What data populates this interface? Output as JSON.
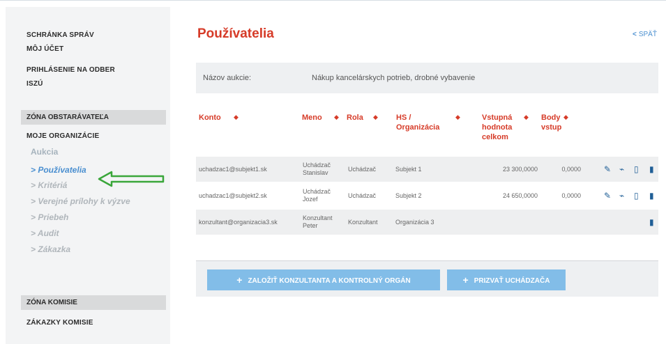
{
  "sidebar": {
    "links": [
      "SCHRÁNKA SPRÁV",
      "MÔJ ÚČET",
      "PRIHLÁSENIE NA ODBER",
      "ISZÚ"
    ],
    "zone_obstaravatela": "ZÓNA OBSTARÁVATEĽA",
    "moje_organizacie": "MOJE ORGANIZÁCIE",
    "aukcia": "Aukcia",
    "sub_items": [
      "> Používatelia",
      "> Kritériá",
      "> Verejné prílohy k výzve",
      "> Priebeh",
      "> Audit",
      "> Zákazka"
    ],
    "zone_komisie": "ZÓNA KOMISIE",
    "zakazky_komisie": "ZÁKAZKY KOMISIE"
  },
  "main": {
    "title": "Používatelia",
    "back_label": "SPÄŤ",
    "info": {
      "label": "Názov aukcie:",
      "value": "Nákup kancelárskych potrieb, drobné vybavenie"
    },
    "columns": {
      "konto": "Konto",
      "meno": "Meno",
      "rola": "Rola",
      "hs_1": "HS /",
      "hs_2": "Organizácia",
      "vstupna_1": "Vstupná",
      "vstupna_2": "hodnota",
      "vstupna_3": "celkom",
      "body_1": "Body",
      "body_2": "vstup"
    },
    "rows": [
      {
        "konto": "uchadzac1@subjekt1.sk",
        "meno_1": "Uchádzač",
        "meno_2": "Stanislav",
        "rola": "Uchádzač",
        "org": "Subjekt 1",
        "hodnota": "23 300,0000",
        "body": "0,0000"
      },
      {
        "konto": "uchadzac1@subjekt2.sk",
        "meno_1": "Uchádzač",
        "meno_2": "Jozef",
        "rola": "Uchádzač",
        "org": "Subjekt 2",
        "hodnota": "24 650,0000",
        "body": "0,0000"
      },
      {
        "konto": "konzultant@organizacia3.sk",
        "meno_1": "Konzultant",
        "meno_2": "Peter",
        "rola": "Konzultant",
        "org": "Organizácia 3",
        "hodnota": "",
        "body": ""
      }
    ],
    "buttons": {
      "add_consultant": "ZALOŽIŤ KONZULTANTA A KONTROLNÝ ORGÁN",
      "invite_bidder": "PRIZVAŤ UCHÁDZAČA"
    }
  },
  "colors": {
    "accent_red": "#d63b28",
    "link_blue": "#4a8fd0",
    "button_blue": "#82bde8",
    "icon_blue": "#1f5e96",
    "arrow_green": "#3aa63a"
  },
  "icons": [
    "pencil-icon",
    "paperclip-icon",
    "pdf-icon",
    "trash-icon",
    "chevron-left-icon",
    "plus-icon",
    "sort-icon",
    "arrow-left-icon"
  ]
}
